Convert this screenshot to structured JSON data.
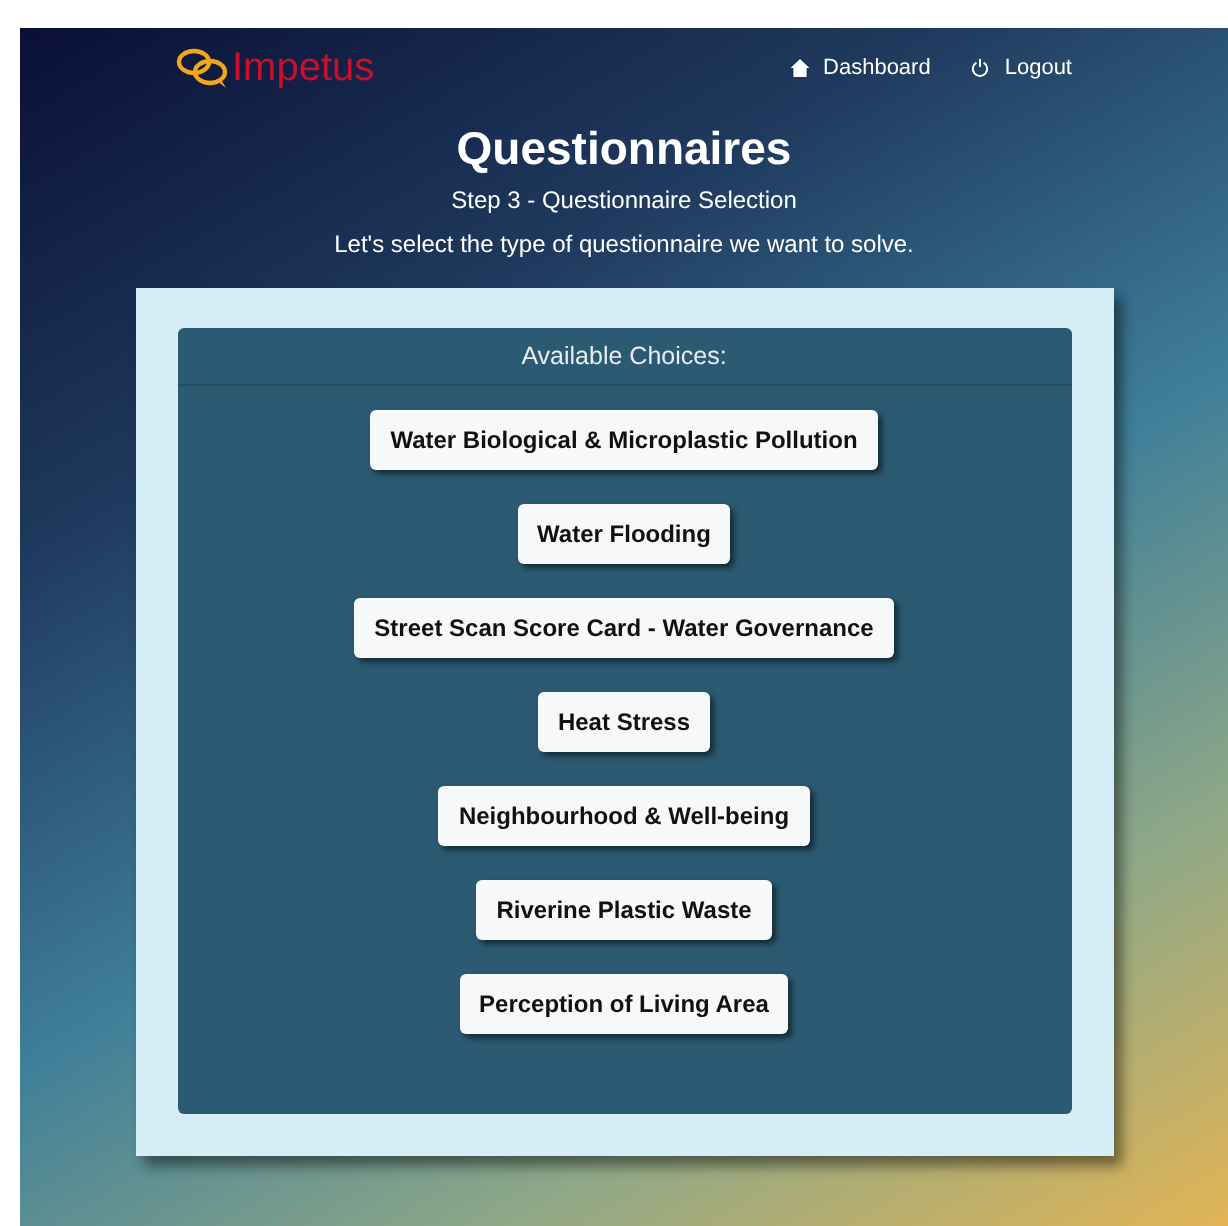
{
  "header": {
    "logo": "Impetus",
    "nav": [
      {
        "label": "Dashboard",
        "kind": "home"
      },
      {
        "label": "Logout",
        "kind": "power"
      }
    ]
  },
  "title": "Questionnaires",
  "subtitle": "Step 3 - Questionnaire Selection",
  "description": "Let's select the type of questionnaire we want to solve.",
  "choices": {
    "heading": "Available Choices:",
    "items": [
      "Water Biological & Microplastic Pollution",
      "Water Flooding",
      "Street Scan Score Card - Water Governance",
      "Heat Stress",
      "Neighbourhood & Well-being",
      "Riverine Plastic Waste",
      "Perception of Living Area"
    ]
  }
}
